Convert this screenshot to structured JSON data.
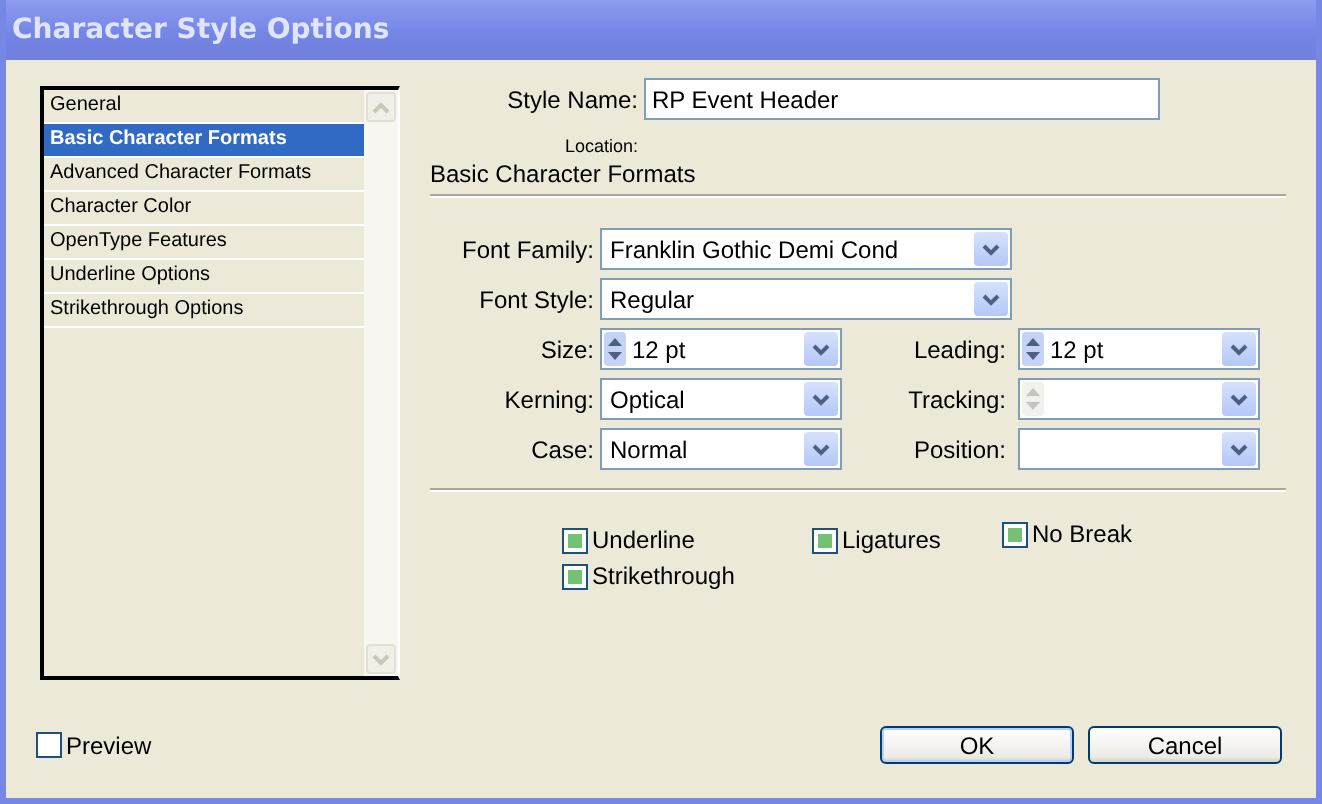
{
  "window": {
    "title": "Character Style Options"
  },
  "sidebar": {
    "items": [
      {
        "label": "General",
        "selected": false
      },
      {
        "label": "Basic Character Formats",
        "selected": true
      },
      {
        "label": "Advanced Character Formats",
        "selected": false
      },
      {
        "label": "Character Color",
        "selected": false
      },
      {
        "label": "OpenType Features",
        "selected": false
      },
      {
        "label": "Underline Options",
        "selected": false
      },
      {
        "label": "Strikethrough Options",
        "selected": false
      }
    ]
  },
  "style_name": {
    "label": "Style Name:",
    "value": "RP Event Header"
  },
  "location": {
    "label": "Location:"
  },
  "section_title": "Basic Character Formats",
  "fields": [
    {
      "kind": "wide",
      "label": "Font Family:",
      "value": "Franklin Gothic Demi Cond"
    },
    {
      "kind": "wide",
      "label": "Font Style:",
      "value": "Regular"
    },
    {
      "kind": "spin",
      "label": "Size:",
      "value": "12 pt",
      "disabled": false
    },
    {
      "kind": "spin",
      "label": "Leading:",
      "value": "12 pt",
      "disabled": false
    },
    {
      "kind": "combo",
      "label": "Kerning:",
      "value": "Optical"
    },
    {
      "kind": "spin",
      "label": "Tracking:",
      "disabled": true
    },
    {
      "kind": "combo",
      "label": "Case:",
      "value": "Normal"
    },
    {
      "kind": "combo",
      "label": "Position:"
    }
  ],
  "checkboxes": [
    {
      "label": "Underline",
      "mixed": true
    },
    {
      "label": "Ligatures",
      "mixed": true
    },
    {
      "label": "No Break",
      "mixed": true
    },
    {
      "label": "Strikethrough",
      "mixed": true
    }
  ],
  "preview": {
    "label": "Preview",
    "checked": false
  },
  "buttons": [
    {
      "label": "OK",
      "default": true
    },
    {
      "label": "Cancel",
      "default": false
    }
  ]
}
